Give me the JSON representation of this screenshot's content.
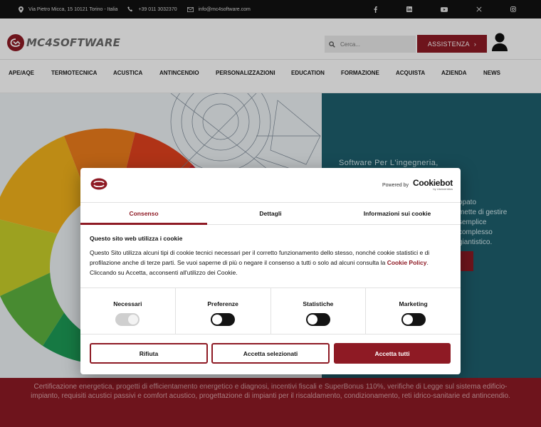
{
  "topbar": {
    "address": "Via Pietro Micca, 15 10121 Torino - Italia",
    "phone": "+39 011 3032370",
    "email": "info@mc4software.com",
    "social_icons": [
      "facebook-icon",
      "linkedin-icon",
      "youtube-icon",
      "x-icon",
      "instagram-icon"
    ]
  },
  "header": {
    "logo_text": "MC4SOFTWARE",
    "search_placeholder": "Cerca...",
    "assist_label": "ASSISTENZA",
    "assist_arrow": "›"
  },
  "nav": {
    "items": [
      "APE/AQE",
      "TERMOTECNICA",
      "ACUSTICA",
      "ANTINCENDIO",
      "PERSONALIZZAZIONI",
      "EDUCATION",
      "FORMAZIONE",
      "ACQUISTA",
      "AZIENDA",
      "NEWS"
    ]
  },
  "hero": {
    "title": "Software Per L'ingegneria,",
    "text_fragments": [
      "opato",
      "mette di gestire",
      "semplice",
      "complesso",
      "giantistico."
    ]
  },
  "band": {
    "text": "Certificazione energetica, progetti di efficientamento energetico e diagnosi, incentivi fiscali e SuperBonus 110%, verifiche di Legge sul sistema edificio-impianto, requisiti acustici passivi e comfort acustico, progettazione di impianti per il riscaldamento, condizionamento, reti idrico-sanitarie ed antincendio."
  },
  "cookie": {
    "powered_by": "Powered by",
    "cookiebot": "Cookiebot",
    "cookiebot_sub": "by Usercentrics",
    "tabs": [
      "Consenso",
      "Dettagli",
      "Informazioni sui cookie"
    ],
    "active_tab": "Consenso",
    "title": "Questo sito web utilizza i cookie",
    "text_before": "Questo Sito utilizza alcuni tipi di cookie tecnici necessari per il corretto funzionamento dello stesso, nonché cookie statistici e di profilazione anche di terze parti. Se vuoi saperne di più o negare il consenso a tutti o solo ad alcuni consulta la ",
    "link": "Cookie Policy",
    "text_after": ". Cliccando su Accetta, acconsenti all'utilizzo dei Cookie.",
    "toggles": [
      {
        "label": "Necessari",
        "on": true,
        "disabled": true
      },
      {
        "label": "Preferenze",
        "on": false,
        "disabled": false
      },
      {
        "label": "Statistiche",
        "on": false,
        "disabled": false
      },
      {
        "label": "Marketing",
        "on": false,
        "disabled": false
      }
    ],
    "buttons": {
      "deny": "Rifiuta",
      "accept_selected": "Accetta selezionati",
      "accept_all": "Accetta tutti"
    }
  },
  "colors": {
    "brand": "#8e1a24",
    "topbar": "#111111",
    "hero_panel": "#1e5f6e"
  }
}
